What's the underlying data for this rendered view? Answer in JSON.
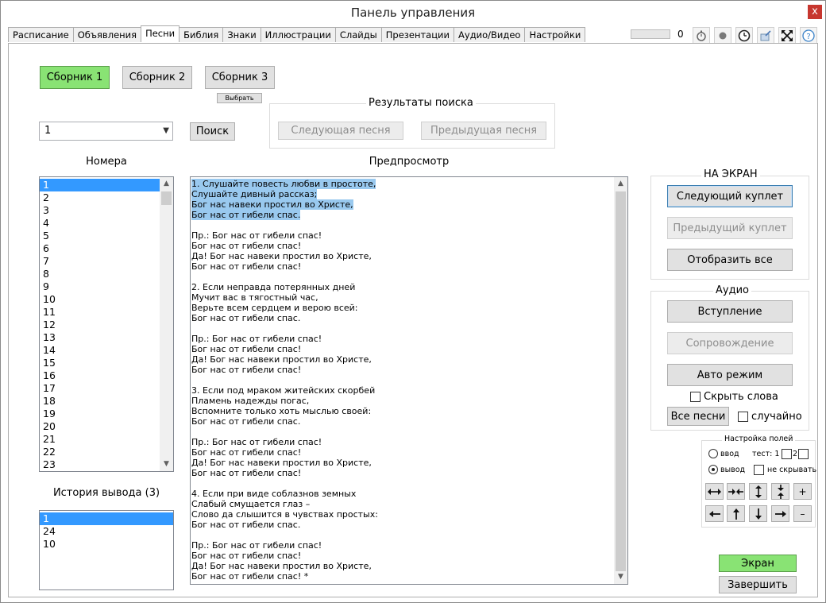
{
  "window": {
    "title": "Панель управления",
    "close": "x"
  },
  "tabs": [
    "Расписание",
    "Объявления",
    "Песни",
    "Библия",
    "Знаки",
    "Иллюстрации",
    "Слайды",
    "Презентации",
    "Аудио/Видео",
    "Настройки"
  ],
  "toolbar": {
    "progress_value": "0"
  },
  "collections": {
    "btn1": "Сборник 1",
    "btn2": "Сборник 2",
    "btn3": "Сборник 3",
    "choose": "Выбрать"
  },
  "search": {
    "combo_value": "1",
    "search_btn": "Поиск",
    "results_title": "Результаты поиска",
    "next_song": "Следующая песня",
    "prev_song": "Предыдущая песня"
  },
  "numbers": {
    "title": "Номера",
    "items": [
      "1",
      "2",
      "3",
      "4",
      "5",
      "6",
      "7",
      "8",
      "9",
      "10",
      "11",
      "12",
      "13",
      "14",
      "15",
      "16",
      "17",
      "18",
      "19",
      "20",
      "21",
      "22",
      "23"
    ]
  },
  "history": {
    "title": "История вывода (3)",
    "items": [
      "1",
      "24",
      "10"
    ]
  },
  "preview": {
    "title": "Предпросмотр",
    "lines": [
      "1. Слушайте повесть любви в простоте,",
      "Слушайте дивный рассказ;",
      "Бог нас навеки простил во Христе,",
      "Бог нас от гибели спас.",
      "",
      "Пр.: Бог нас от гибели спас!",
      "Бог нас от гибели спас!",
      "Да! Бог нас навеки простил во Христе,",
      "Бог нас от гибели спас!",
      "",
      "2. Если неправда потерянных дней",
      "Мучит вас в тягостный час,",
      "Верьте всем сердцем и верою всей:",
      "Бог нас от гибели спас.",
      "",
      "Пр.: Бог нас от гибели спас!",
      "Бог нас от гибели спас!",
      "Да! Бог нас навеки простил во Христе,",
      "Бог нас от гибели спас!",
      "",
      "3. Если под мраком житейских скорбей",
      "Пламень надежды погас,",
      "Вспомните только хоть мыслью своей:",
      "Бог нас от гибели спас.",
      "",
      "Пр.: Бог нас от гибели спас!",
      "Бог нас от гибели спас!",
      "Да! Бог нас навеки простил во Христе,",
      "Бог нас от гибели спас!",
      "",
      "4. Если при виде соблазнов земных",
      "Слабый смущается глаз –",
      "Слово да слышится в чувствах простых:",
      "Бог нас от гибели спас.",
      "",
      "Пр.: Бог нас от гибели спас!",
      "Бог нас от гибели спас!",
      "Да! Бог нас навеки простил во Христе,",
      "Бог нас от гибели спас! *"
    ]
  },
  "screen": {
    "title": "НА ЭКРАН",
    "next_verse": "Следующий куплет",
    "prev_verse": "Предыдущий куплет",
    "show_all": "Отобразить все"
  },
  "audio": {
    "title": "Аудио",
    "intro": "Вступление",
    "accomp": "Сопровождение",
    "auto": "Авто режим",
    "hide_words": "Скрыть слова",
    "all_songs": "Все песни",
    "random": "случайно"
  },
  "fields": {
    "title": "Настройка полей",
    "input": "ввод",
    "output": "вывод",
    "test": "тест: 1",
    "test2": "2",
    "no_hide": "не скрывать",
    "plus": "+",
    "minus": "–"
  },
  "bottom": {
    "screen_btn": "Экран",
    "finish_btn": "Завершить"
  }
}
